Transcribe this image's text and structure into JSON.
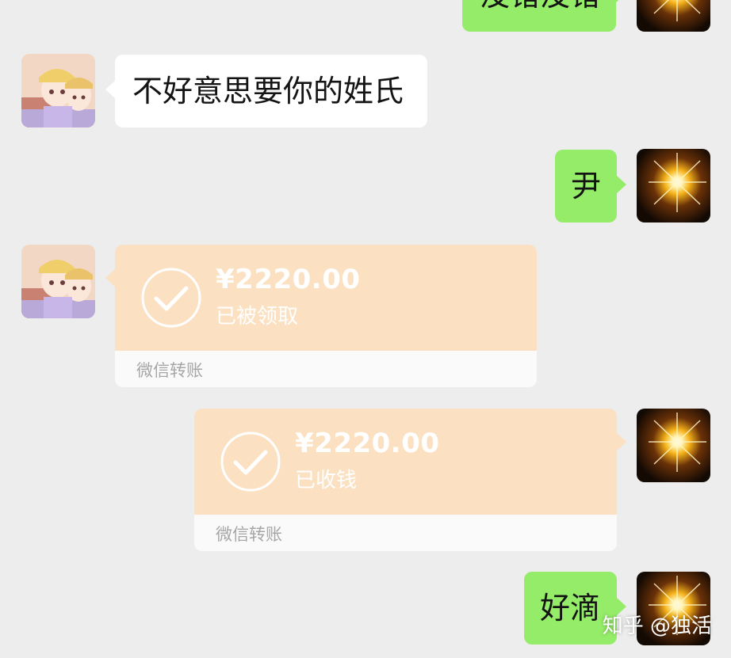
{
  "messages": [
    {
      "side": "out",
      "text": "没错没错"
    },
    {
      "side": "in",
      "text": "不好意思要你的姓氏"
    },
    {
      "side": "out",
      "text": "尹"
    },
    {
      "side": "in",
      "type": "transfer",
      "amount": "¥2220.00",
      "status": "已被领取",
      "label": "微信转账"
    },
    {
      "side": "out",
      "type": "transfer",
      "amount": "¥2220.00",
      "status": "已收钱",
      "label": "微信转账"
    },
    {
      "side": "out",
      "text": "好滴"
    }
  ],
  "watermark": "知乎 @独活",
  "colors": {
    "background": "#ededed",
    "bubble_in": "#ffffff",
    "bubble_out": "#95ec69",
    "transfer_top": "#fbe1c2",
    "transfer_bottom": "#fafafa"
  },
  "icons": {
    "self_avatar": "sun-flare-avatar",
    "other_avatar": "anime-girls-avatar",
    "transfer_icon": "check-circle-icon"
  }
}
